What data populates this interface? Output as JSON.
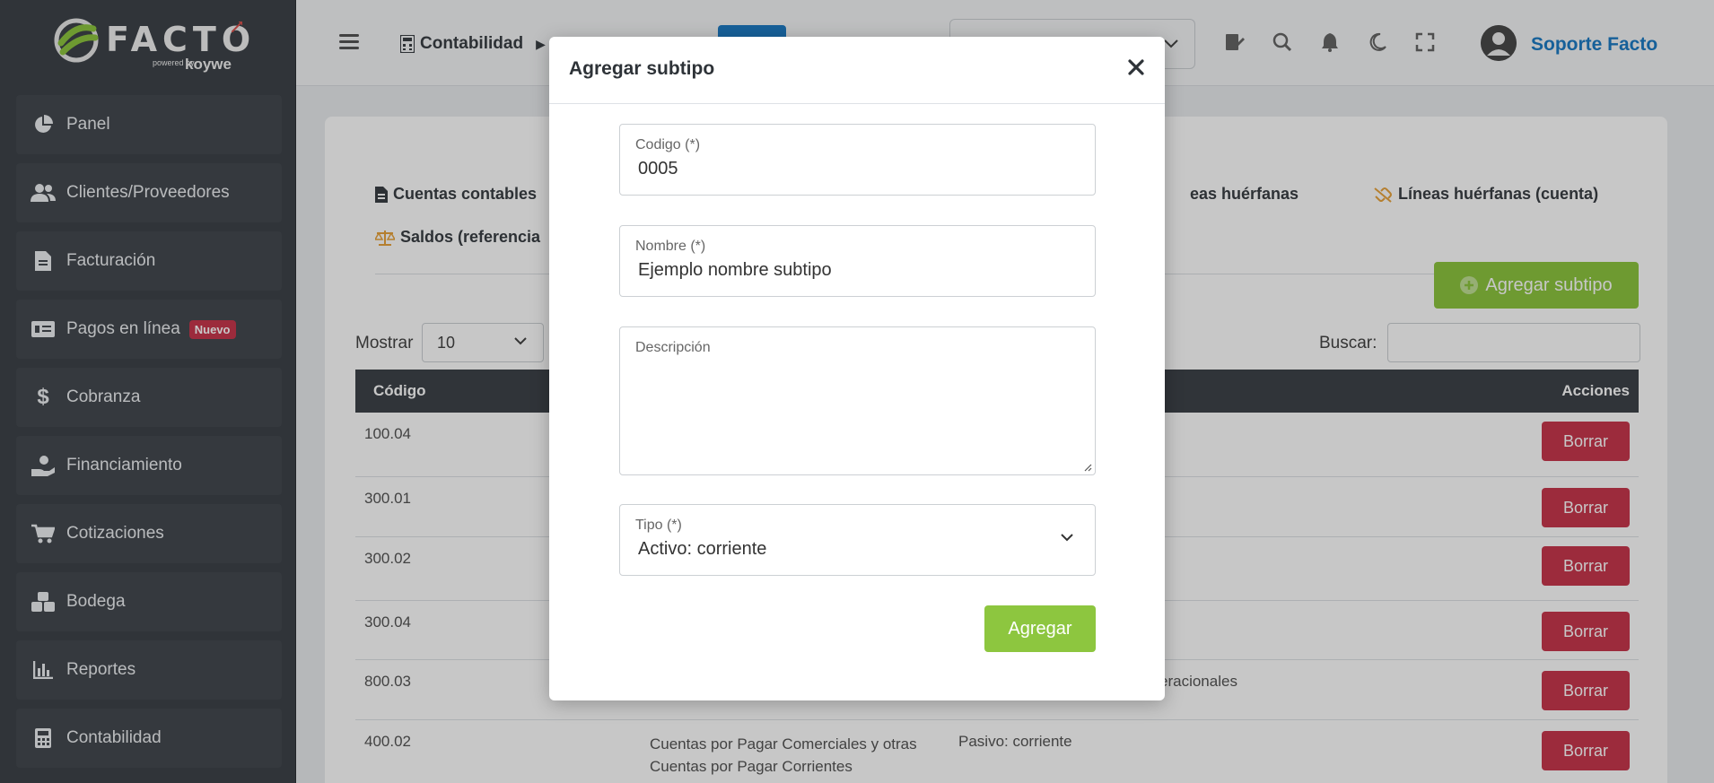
{
  "brand": {
    "name": "FACTO",
    "powered_by": "powered by",
    "partner": "koywe"
  },
  "sidebar": {
    "items": [
      {
        "label": "Panel",
        "icon": "pie-chart-icon"
      },
      {
        "label": "Clientes/Proveedores",
        "icon": "users-icon"
      },
      {
        "label": "Facturación",
        "icon": "document-icon"
      },
      {
        "label": "Pagos en línea",
        "icon": "money-bill-icon",
        "badge": "Nuevo"
      },
      {
        "label": "Cobranza",
        "icon": "dollar-icon"
      },
      {
        "label": "Financiamiento",
        "icon": "hand-coin-icon"
      },
      {
        "label": "Cotizaciones",
        "icon": "cart-icon"
      },
      {
        "label": "Bodega",
        "icon": "boxes-icon"
      },
      {
        "label": "Reportes",
        "icon": "bar-chart-icon"
      },
      {
        "label": "Contabilidad",
        "icon": "calculator-icon"
      }
    ]
  },
  "topbar": {
    "breadcrumb": "Contabilidad",
    "user_name": "Soporte Facto"
  },
  "tabs": [
    {
      "label": "Cuentas contables"
    },
    {
      "label": "eas huérfanas"
    },
    {
      "label": "Líneas huérfanas (cuenta)"
    },
    {
      "label": "Saldos (referencia"
    }
  ],
  "toolbar": {
    "add_label": "Agregar subtipo",
    "show_label": "Mostrar",
    "show_value": "10",
    "search_label": "Buscar:"
  },
  "table": {
    "headers": {
      "code": "Código",
      "actions": "Acciones"
    },
    "rows": [
      {
        "code": "100.04",
        "name": "",
        "type": "",
        "extra": "",
        "action": "Borrar"
      },
      {
        "code": "300.01",
        "name": "",
        "type": "",
        "extra": "",
        "action": "Borrar"
      },
      {
        "code": "300.02",
        "name": "",
        "type": "",
        "extra": "",
        "action": "Borrar"
      },
      {
        "code": "300.04",
        "name": "",
        "type": "",
        "extra": "",
        "action": "Borrar"
      },
      {
        "code": "800.03",
        "name": "",
        "type": "",
        "extra": "eracionales",
        "action": "Borrar"
      },
      {
        "code": "400.02",
        "name": "Cuentas por Pagar Comerciales y otras Cuentas por Pagar Corrientes",
        "type": "Pasivo: corriente",
        "extra": "",
        "action": "Borrar"
      }
    ]
  },
  "modal": {
    "title": "Agregar subtipo",
    "codigo": {
      "label": "Codigo (*)",
      "value": "0005"
    },
    "nombre": {
      "label": "Nombre (*)",
      "value": "Ejemplo nombre subtipo"
    },
    "descripcion": {
      "label": "Descripción",
      "value": ""
    },
    "tipo": {
      "label": "Tipo (*)",
      "value": "Activo: corriente"
    },
    "submit_label": "Agregar"
  },
  "colors": {
    "accent_green": "#8dc63f",
    "danger": "#c8384d",
    "brand_blue": "#1d7bc4",
    "sidebar_bg": "#3e4349"
  }
}
